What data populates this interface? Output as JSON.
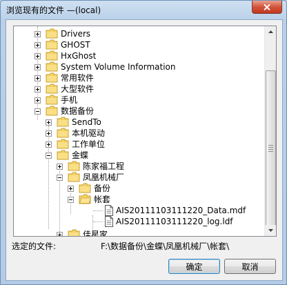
{
  "window": {
    "title": "浏览现有的文件 —(local)"
  },
  "tree": {
    "items": [
      {
        "label": "Drivers"
      },
      {
        "label": "GHOST"
      },
      {
        "label": "HxGhost"
      },
      {
        "label": "System Volume Information"
      },
      {
        "label": "常用软件"
      },
      {
        "label": "大型软件"
      },
      {
        "label": "手机"
      },
      {
        "label": "数据备份"
      },
      {
        "label": "SendTo"
      },
      {
        "label": "本机驱动"
      },
      {
        "label": "工作单位"
      },
      {
        "label": "金蝶"
      },
      {
        "label": "陈家福工程"
      },
      {
        "label": "凤凰机械厂"
      },
      {
        "label": "备份"
      },
      {
        "label": "帐套"
      },
      {
        "label": "AIS20111103111220_Data.mdf"
      },
      {
        "label": "AIS20111103111220_log.ldf"
      },
      {
        "label": "佳星家"
      }
    ]
  },
  "selection": {
    "label": "选定的文件:",
    "path": "F:\\数据备份\\金蝶\\凤凰机械厂\\帐套\\"
  },
  "buttons": {
    "ok": "确定",
    "cancel": "取消"
  },
  "icons": {
    "folder": "folder-icon",
    "open_folder": "folder-open-icon",
    "file": "file-icon",
    "close": "close-icon",
    "scroll_up": "chevron-up-icon",
    "scroll_down": "chevron-down-icon"
  },
  "colors": {
    "folder": "#f2c94c",
    "close_button": "#c9452a"
  }
}
